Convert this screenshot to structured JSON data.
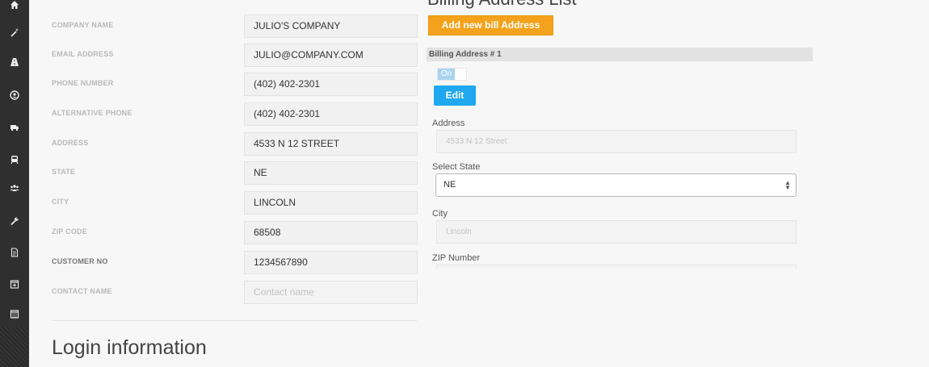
{
  "sidebar": {
    "icons": [
      "home-icon",
      "wand-icon",
      "road-icon",
      "user-circle-icon",
      "truck-icon",
      "train-icon",
      "group-icon",
      "wrench-icon",
      "document-icon",
      "calendar-plus-icon",
      "calendar-icon"
    ]
  },
  "customer_form": {
    "company_name": {
      "label": "COMPANY NAME",
      "value": "JULIO'S COMPANY"
    },
    "email": {
      "label": "EMAIL ADDRESS",
      "value": "JULIO@COMPANY.COM"
    },
    "phone": {
      "label": "PHONE NUMBER",
      "value": "(402) 402-2301"
    },
    "alt_phone": {
      "label": "ALTERNATIVE PHONE",
      "value": "(402) 402-2301"
    },
    "address": {
      "label": "ADDRESS",
      "value": "4533 N 12 STREET"
    },
    "state": {
      "label": "STATE",
      "value": "NE"
    },
    "city": {
      "label": "CITY",
      "value": "LINCOLN"
    },
    "zip": {
      "label": "ZIP CODE",
      "value": "68508"
    },
    "customer_no": {
      "label": "CUSTOMER NO",
      "value": "1234567890"
    },
    "contact_name": {
      "label": "CONTACT NAME",
      "value": "",
      "placeholder": "Contact name"
    }
  },
  "login": {
    "title": "Login information"
  },
  "billing": {
    "title": "Billing Address List",
    "add_button": "Add new bill Address",
    "address_header": "Billing Address # 1",
    "toggle_label": "On",
    "edit_button": "Edit",
    "address_label": "Address",
    "address_value": "4533 N 12 Street",
    "state_label": "Select State",
    "state_value": "NE",
    "city_label": "City",
    "city_value": "Lincoln",
    "zip_label": "ZIP Number"
  },
  "colors": {
    "accent_orange": "#f4a21b",
    "accent_blue": "#1fa8ef",
    "sidebar": "#2f2f2f"
  }
}
